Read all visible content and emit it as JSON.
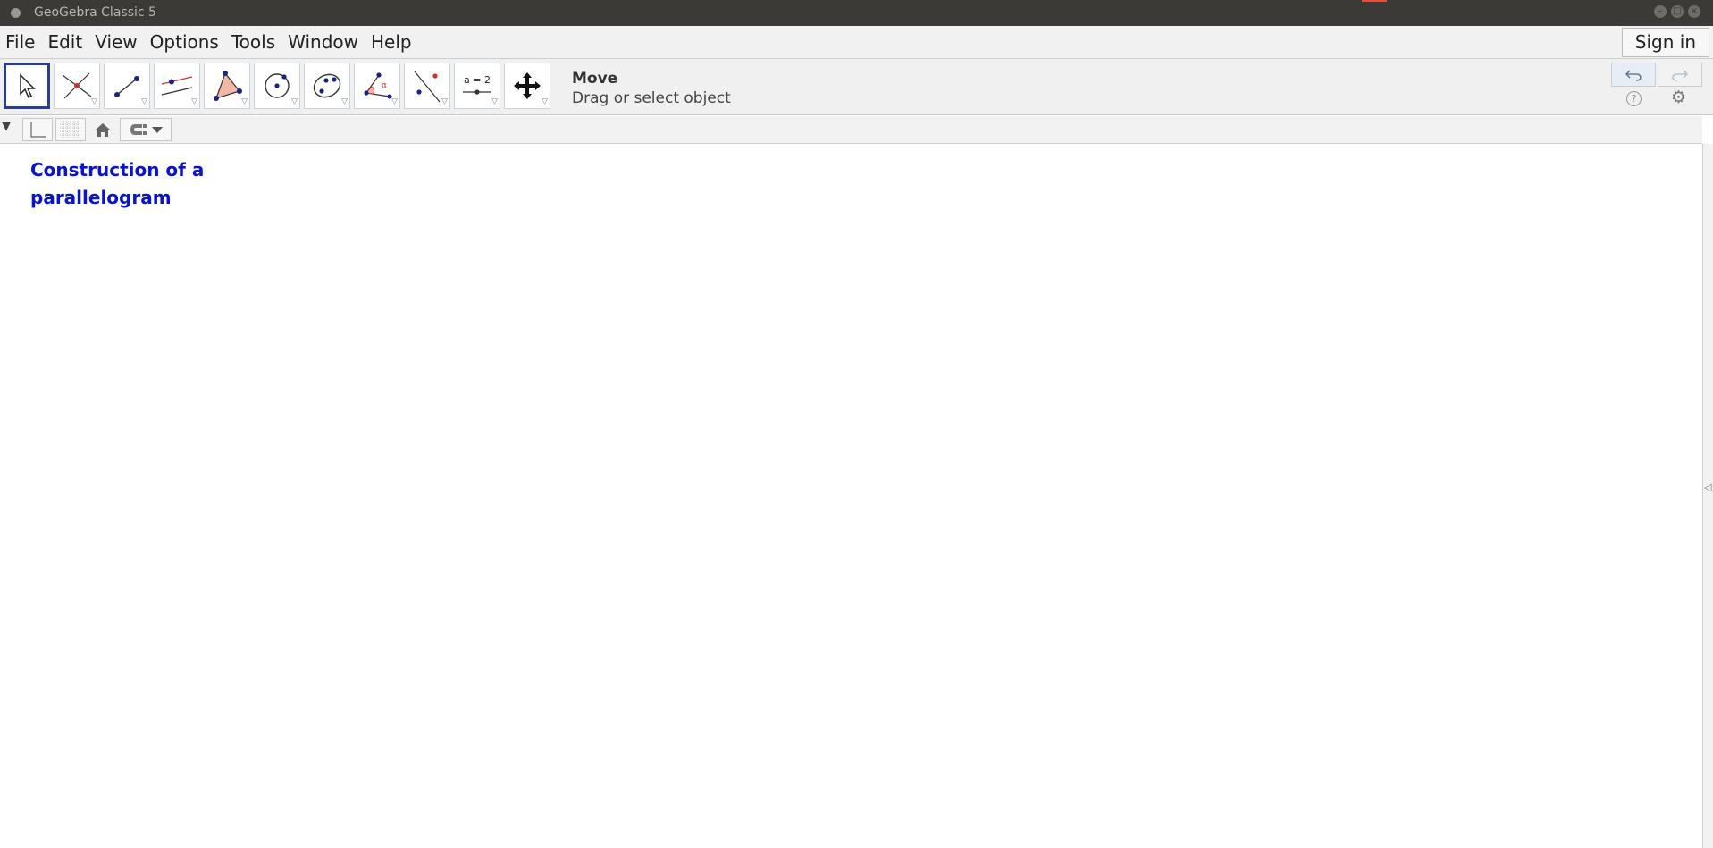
{
  "window": {
    "title": "GeoGebra Classic 5"
  },
  "menubar": {
    "items": [
      "File",
      "Edit",
      "View",
      "Options",
      "Tools",
      "Window",
      "Help"
    ],
    "signin_label": "Sign in"
  },
  "toolbar": {
    "tools": [
      {
        "name": "move",
        "icon": "pointer-arrow-icon",
        "selected": true
      },
      {
        "name": "point",
        "icon": "intersect-point-icon"
      },
      {
        "name": "segment",
        "icon": "segment-icon"
      },
      {
        "name": "parallel-line",
        "icon": "parallel-line-icon"
      },
      {
        "name": "polygon",
        "icon": "polygon-icon"
      },
      {
        "name": "circle",
        "icon": "circle-center-point-icon"
      },
      {
        "name": "conic",
        "icon": "ellipse-icon"
      },
      {
        "name": "angle",
        "icon": "angle-icon"
      },
      {
        "name": "reflect",
        "icon": "reflect-line-icon"
      },
      {
        "name": "slider",
        "icon": "slider-icon",
        "label": "a = 2"
      },
      {
        "name": "move-graphics",
        "icon": "move-view-icon"
      }
    ],
    "tool_help": {
      "name": "Move",
      "description": "Drag or select object"
    }
  },
  "canvas": {
    "caption_lines": [
      "Construction of a",
      "parallelogram"
    ],
    "caption_color": "#0a14c8"
  },
  "colors": {
    "accent": "#2b3e8c",
    "point": "#1a237e",
    "highlight": "#d32f2f"
  }
}
